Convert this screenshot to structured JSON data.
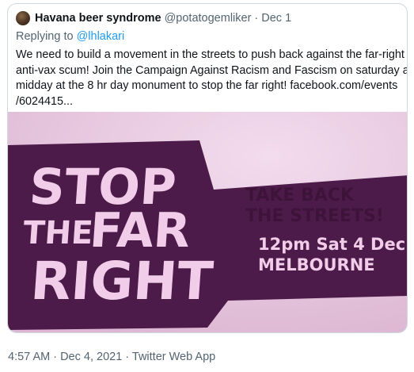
{
  "tweet": {
    "author_name": "Havana beer syndrome",
    "author_handle": "@potatogemliker",
    "separator": "·",
    "date": "Dec 1",
    "reply_prefix": "Replying to",
    "reply_to": "@lhlakari",
    "body_lines": [
      "We need to build a movement in the streets to push back against the far-right",
      "anti-vax scum! Join the Campaign Against Racism and Fascism on saturday at",
      "midday at the 8 hr day monument to stop the far right! facebook.com/events",
      "/6024415..."
    ]
  },
  "poster": {
    "big_words": [
      "STOP",
      "THE",
      "FAR",
      "RIGHT"
    ],
    "tagline_1": "TAKE BACK",
    "tagline_2": "THE STREETS!",
    "event_time": "12pm Sat 4 Dec",
    "event_city": "MELBOURNE",
    "colors": {
      "background": "#e6c7de",
      "band": "#4d1b4a",
      "light_text": "#f1cde9",
      "dark_text": "#3e1339"
    }
  },
  "footer": {
    "meta": "4:57 AM · Dec 4, 2021 · Twitter Web App"
  },
  "colors": {
    "text_primary": "#0f1419",
    "text_secondary": "#536471",
    "link": "#1d9bf0",
    "border": "#cfd9de"
  }
}
